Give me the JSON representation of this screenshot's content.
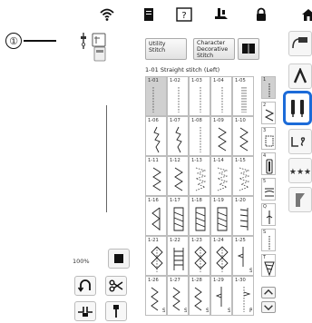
{
  "callout": {
    "number": "①"
  },
  "tabs": {
    "utility": {
      "line1": "Utility",
      "line2": "Stitch"
    },
    "character": {
      "line1": "Character",
      "line2": "Decorative",
      "line3": "Stitch"
    }
  },
  "subtitle": "1-01 Straight stitch (Left)",
  "width_percent": "100%",
  "accent_color": "#1c6bd8",
  "stitches": [
    {
      "id": "1-01",
      "kind": "straight-left",
      "selected": true
    },
    {
      "id": "1-02",
      "kind": "straight-mid"
    },
    {
      "id": "1-03",
      "kind": "straight-mid"
    },
    {
      "id": "1-04",
      "kind": "straight-mid"
    },
    {
      "id": "1-05",
      "kind": "triple-straight"
    },
    {
      "id": "1-06",
      "kind": "stretch"
    },
    {
      "id": "1-07",
      "kind": "stretch"
    },
    {
      "id": "1-08",
      "kind": "straight-mid"
    },
    {
      "id": "1-09",
      "kind": "zigzag"
    },
    {
      "id": "1-10",
      "kind": "zigzag"
    },
    {
      "id": "1-11",
      "kind": "zigzag"
    },
    {
      "id": "1-12",
      "kind": "zigzag"
    },
    {
      "id": "1-13",
      "kind": "three-step"
    },
    {
      "id": "1-14",
      "kind": "three-step"
    },
    {
      "id": "1-15",
      "kind": "three-step"
    },
    {
      "id": "1-16",
      "kind": "overcast"
    },
    {
      "id": "1-17",
      "kind": "overcast-box"
    },
    {
      "id": "1-18",
      "kind": "overcast-box"
    },
    {
      "id": "1-19",
      "kind": "overcast-box"
    },
    {
      "id": "1-20",
      "kind": "overcast-edge"
    },
    {
      "id": "1-21",
      "kind": "diamond"
    },
    {
      "id": "1-22",
      "kind": "ladder"
    },
    {
      "id": "1-23",
      "kind": "diamond"
    },
    {
      "id": "1-24",
      "kind": "diamond"
    },
    {
      "id": "1-25",
      "kind": "blind-s",
      "tag": "S"
    },
    {
      "id": "1-26",
      "kind": "zigzag-s",
      "tag": "S"
    },
    {
      "id": "1-27",
      "kind": "zigzag-s",
      "tag": "S"
    },
    {
      "id": "1-28",
      "kind": "zigzag-s",
      "tag": "S"
    },
    {
      "id": "1-29",
      "kind": "blind-s",
      "tag": "S"
    },
    {
      "id": "1-30",
      "kind": "blind-p",
      "tag": "P"
    }
  ],
  "scroll_items": [
    {
      "label": "1",
      "kind": "straight",
      "selected": true
    },
    {
      "label": "2",
      "kind": "zigzag"
    },
    {
      "label": "3",
      "kind": "box"
    },
    {
      "label": "4",
      "kind": "buttonhole"
    },
    {
      "label": "5",
      "kind": "wave"
    },
    {
      "label": "Q",
      "kind": "quilt"
    },
    {
      "label": "S",
      "kind": "straight"
    },
    {
      "label": "T",
      "kind": "taper"
    }
  ],
  "icons": {
    "status": [
      "wifi-icon",
      "document-icon",
      "help-icon",
      "presser-foot-icon",
      "lock-icon",
      "home-icon"
    ],
    "controls": [
      "reverse-icon",
      "scissors-icon",
      "thread-cutter-icon",
      "needle-position-icon"
    ],
    "right": [
      "stitch-type-icon",
      "needle-icon",
      "twin-needle-icon",
      "memory-icon",
      "stars-icon",
      "flag-icon"
    ]
  }
}
